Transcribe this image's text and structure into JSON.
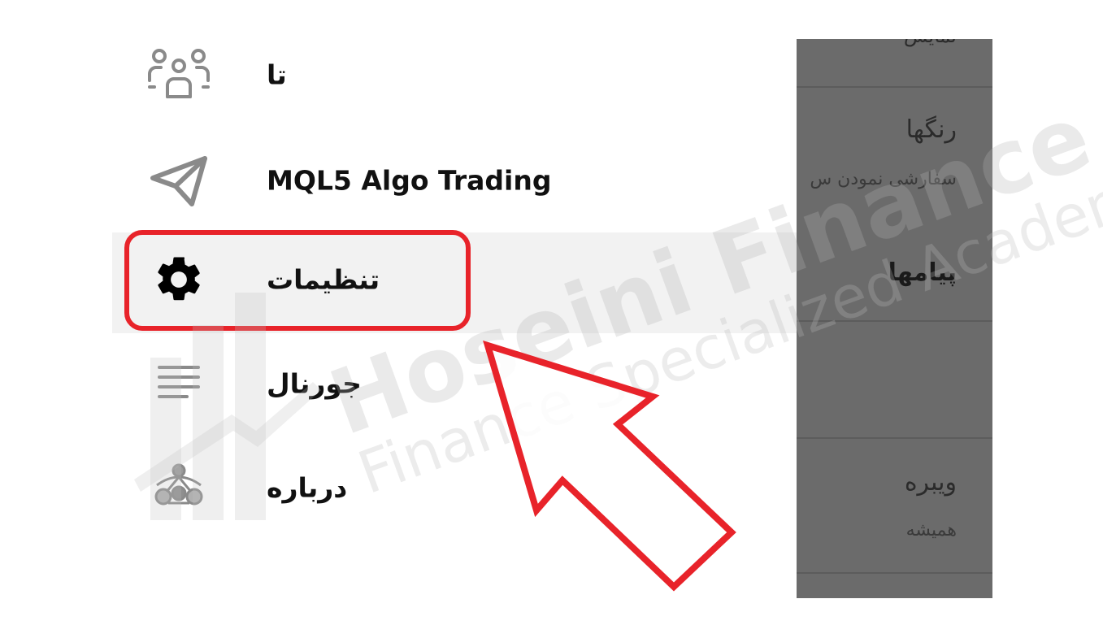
{
  "menu": {
    "items": [
      {
        "label": "تا",
        "icon": "people-icon"
      },
      {
        "label": "MQL5 Algo Trading",
        "icon": "telegram-icon"
      },
      {
        "label": "تنظیمات",
        "icon": "gear-icon"
      },
      {
        "label": "جورنال",
        "icon": "journal-lines-icon"
      },
      {
        "label": "درباره",
        "icon": "metatrader-logo-icon"
      }
    ],
    "selected_index": 2
  },
  "settings_panel": {
    "top_cut": "نمایش",
    "colors_title": "رنگها",
    "colors_sub": "سفارشی نمودن س",
    "messages": "پیامها",
    "edit_title": "ویبره",
    "edit_sub": "همیشه"
  },
  "watermark": {
    "title": "Hoseini Finance",
    "subtitle": "Finance Specialized Academy"
  },
  "colors": {
    "highlight": "#e8232a",
    "panel_dim": "#6b6b6b"
  }
}
